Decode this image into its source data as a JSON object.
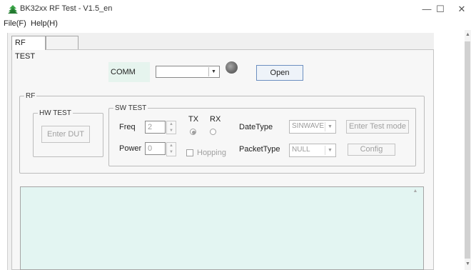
{
  "window": {
    "title": "BK32xx RF Test - V1.5_en",
    "minimize_glyph": "—",
    "maximize_glyph": "☐",
    "close_glyph": "✕"
  },
  "menu": {
    "file": "File(F)",
    "help": "Help(H)"
  },
  "tabs": [
    {
      "label": "RF TEST",
      "active": true
    },
    {
      "label": "",
      "active": false
    }
  ],
  "comm": {
    "label": "COMM",
    "port_value": "",
    "open_button": "Open",
    "status_led": "gray"
  },
  "rf_group": {
    "legend": "RF",
    "hw_test": {
      "legend": "HW TEST",
      "enter_dut_button": "Enter DUT"
    },
    "sw_test": {
      "legend": "SW TEST",
      "freq_label": "Freq",
      "freq_value": "2",
      "power_label": "Power",
      "power_value": "0",
      "tx_label": "TX",
      "rx_label": "RX",
      "tx_selected": true,
      "hopping_label": "Hopping",
      "hopping_checked": false,
      "datatype_label": "DateType",
      "datatype_value": "SINWAVE",
      "packettype_label": "PacketType",
      "packettype_value": "NULL",
      "enter_test_mode_button": "Enter Test mode",
      "config_button": "Config"
    }
  },
  "log": {
    "content": ""
  },
  "colors": {
    "log_background": "#e3f5f2",
    "comm_label_background": "#e6f4ee",
    "open_button_border": "#6c8fc0",
    "disabled_text": "#a0a0a0"
  }
}
